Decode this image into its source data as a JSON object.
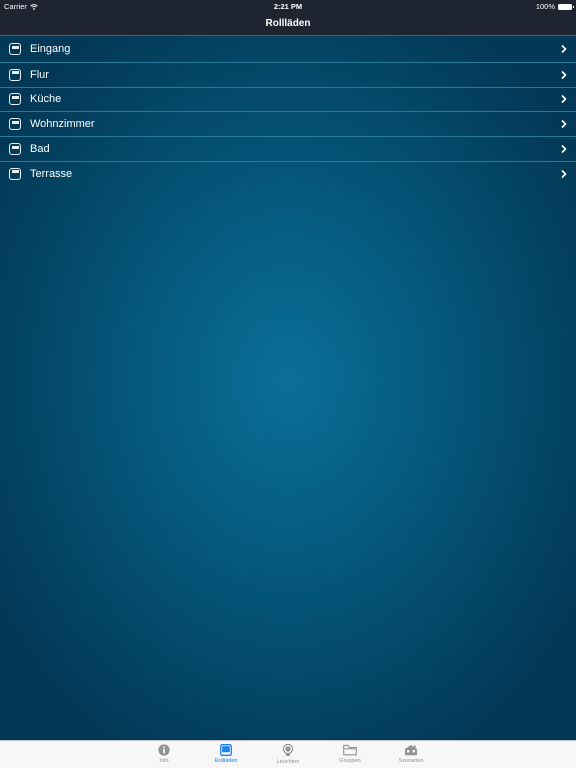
{
  "status_bar": {
    "carrier": "Carrier",
    "time": "2:21 PM",
    "battery": "100%"
  },
  "nav": {
    "title": "Rollläden"
  },
  "list": {
    "items": [
      {
        "label": "Eingang",
        "icon": "shutter-icon"
      },
      {
        "label": "Flur",
        "icon": "shutter-icon"
      },
      {
        "label": "Küche",
        "icon": "shutter-icon"
      },
      {
        "label": "Wohnzimmer",
        "icon": "shutter-icon"
      },
      {
        "label": "Bad",
        "icon": "shutter-icon"
      },
      {
        "label": "Terrasse",
        "icon": "shutter-icon"
      }
    ]
  },
  "tabbar": {
    "tabs": [
      {
        "label": "Info",
        "icon": "info-icon",
        "active": false
      },
      {
        "label": "Rollläden",
        "icon": "shutter-icon",
        "active": true
      },
      {
        "label": "Leuchten",
        "icon": "lightbulb-icon",
        "active": false
      },
      {
        "label": "Gruppen",
        "icon": "folder-icon",
        "active": false
      },
      {
        "label": "Szenarien",
        "icon": "house-icon",
        "active": false
      }
    ]
  },
  "colors": {
    "accent": "#1a82ea",
    "inactive": "#929292",
    "background": "#05587c",
    "bar": "#1e2530"
  }
}
